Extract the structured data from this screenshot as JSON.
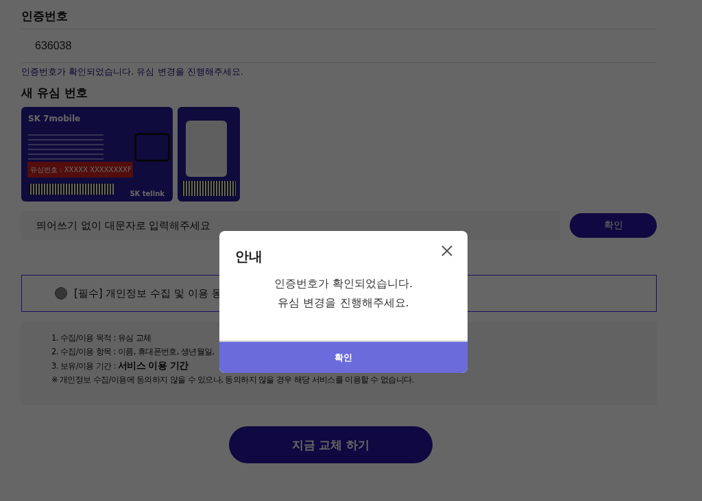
{
  "auth_section": {
    "title": "인증번호",
    "code_value": "636038",
    "message": "인증번호가 확인되었습니다. 유심 변경을 진행해주세요."
  },
  "sim_section": {
    "title": "새 유심 번호",
    "card_logo": "SK 7mobile",
    "card_number_label": "유심번호 : XXXXX XXXXXXXXF",
    "card_brand": "SK telink",
    "input_placeholder": "띄어쓰기 없이 대문자로 입력해주세요",
    "confirm_button": "확인"
  },
  "agreement": {
    "label": "[필수] 개인정보 수집 및 이용 동",
    "checked": false,
    "items": [
      "1. 수집/이용 목적 : 유심 교체",
      "2. 수집/이용 항목 : 이름, 휴대폰번호, 생년월일,",
      "3. 보유/이용 기간 : **서비스 이용 기간**",
      "※ 개인정보 수집/이용에 동의하지 않을 수 있으나, 동의하지 않을 경우 해당 서비스를 이용할 수 없습니다."
    ]
  },
  "submit_button": "지금 교체 하기",
  "dialog": {
    "title": "안내",
    "lines": [
      "인증번호가 확인되었습니다.",
      "유심 변경을 진행해주세요."
    ],
    "button": "확인"
  }
}
